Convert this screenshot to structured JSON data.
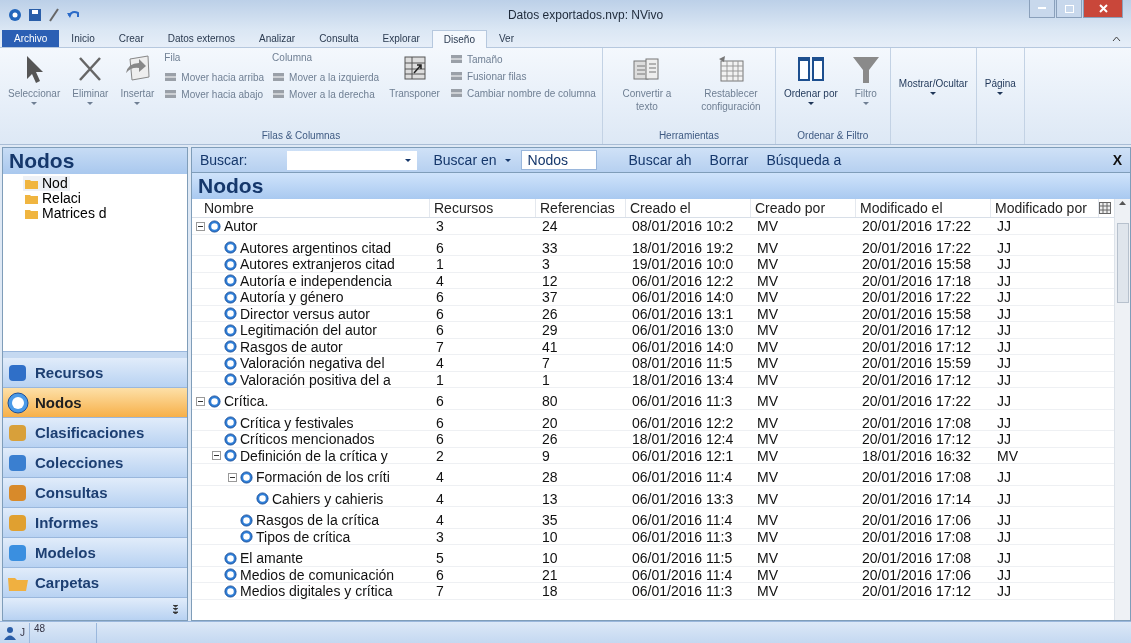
{
  "window": {
    "title": "Datos exportados.nvp: NVivo"
  },
  "ribbon_tabs": [
    {
      "label": "Archivo",
      "kind": "file",
      "selected": false
    },
    {
      "label": "Inicio",
      "kind": "tab",
      "selected": false
    },
    {
      "label": "Crear",
      "kind": "tab",
      "selected": false
    },
    {
      "label": "Datos externos",
      "kind": "tab",
      "selected": false
    },
    {
      "label": "Analizar",
      "kind": "tab",
      "selected": false
    },
    {
      "label": "Consulta",
      "kind": "tab",
      "selected": false
    },
    {
      "label": "Explorar",
      "kind": "tab",
      "selected": false
    },
    {
      "label": "Diseño",
      "kind": "tab",
      "selected": true
    },
    {
      "label": "Ver",
      "kind": "tab",
      "selected": false
    }
  ],
  "ribbon_groups": [
    {
      "label": "Filas & Columnas",
      "items": [
        {
          "kind": "large",
          "label": "Seleccionar",
          "dropdown": true,
          "disabled": true
        },
        {
          "kind": "large",
          "label": "Eliminar",
          "dropdown": true,
          "disabled": true
        },
        {
          "kind": "large",
          "label": "Insertar",
          "dropdown": true,
          "disabled": true
        },
        {
          "kind": "stack",
          "heading": "Fila",
          "entries": [
            {
              "label": "Mover hacia arriba",
              "disabled": true
            },
            {
              "label": "Mover hacia abajo",
              "disabled": true
            }
          ]
        },
        {
          "kind": "stack",
          "heading": "Columna",
          "entries": [
            {
              "label": "Mover a la izquierda",
              "disabled": true
            },
            {
              "label": "Mover a la derecha",
              "disabled": true
            }
          ]
        },
        {
          "kind": "large",
          "label": "Transponer",
          "dropdown": false,
          "disabled": true
        },
        {
          "kind": "stack",
          "entries": [
            {
              "label": "Tamaño",
              "disabled": true
            },
            {
              "label": "Fusionar filas",
              "disabled": true
            },
            {
              "label": "Cambiar nombre de columna",
              "disabled": true
            }
          ]
        }
      ]
    },
    {
      "label": "Herramientas",
      "items": [
        {
          "kind": "large",
          "label": "Convertir a texto",
          "dropdown": false,
          "disabled": true
        },
        {
          "kind": "large",
          "label": "Restablecer configuración",
          "dropdown": false,
          "disabled": true
        }
      ]
    },
    {
      "label": "Ordenar & Filtro",
      "items": [
        {
          "kind": "large",
          "label": "Ordenar por",
          "dropdown": true,
          "disabled": false
        },
        {
          "kind": "large",
          "label": "Filtro",
          "dropdown": true,
          "disabled": true
        }
      ]
    },
    {
      "items": [
        {
          "kind": "text",
          "label": "Mostrar/Ocultar",
          "dropdown": true,
          "disabled": false
        }
      ]
    },
    {
      "items": [
        {
          "kind": "text",
          "label": "Página",
          "dropdown": true,
          "disabled": false
        }
      ]
    }
  ],
  "navigation": {
    "title": "Nodos",
    "folders": [
      {
        "label": "Nod",
        "selected": true
      },
      {
        "label": "Relaci",
        "selected": false
      },
      {
        "label": "Matrices d",
        "selected": false
      }
    ],
    "sections": [
      {
        "label": "Recursos",
        "selected": false
      },
      {
        "label": "Nodos",
        "selected": true
      },
      {
        "label": "Clasificaciones",
        "selected": false
      },
      {
        "label": "Colecciones",
        "selected": false
      },
      {
        "label": "Consultas",
        "selected": false
      },
      {
        "label": "Informes",
        "selected": false
      },
      {
        "label": "Modelos",
        "selected": false
      },
      {
        "label": "Carpetas",
        "selected": false
      }
    ]
  },
  "find_bar": {
    "label": "Buscar:",
    "look_in_label": "Buscar en",
    "look_in_value": "Nodos",
    "find_now": "Buscar ah",
    "clear": "Borrar",
    "advanced": "Búsqueda a",
    "close": "X"
  },
  "list": {
    "title": "Nodos",
    "columns": [
      "Nombre",
      "Recursos",
      "Referencias",
      "Creado el",
      "Creado por",
      "Modificado el",
      "Modificado por"
    ],
    "rows": [
      {
        "name": "Autor",
        "sources": "3",
        "references": "24",
        "created_on": "08/01/2016 10:2",
        "created_by": "MV",
        "modified_on": "20/01/2016 17:22",
        "modified_by": "JJ",
        "expanded": true,
        "children": [
          {
            "name": "Autores argentinos citad",
            "sources": "6",
            "references": "33",
            "created_on": "18/01/2016 19:2",
            "created_by": "MV",
            "modified_on": "20/01/2016 17:22",
            "modified_by": "JJ"
          },
          {
            "name": "Autores extranjeros citad",
            "sources": "1",
            "references": "3",
            "created_on": "19/01/2016 10:0",
            "created_by": "MV",
            "modified_on": "20/01/2016 15:58",
            "modified_by": "JJ"
          },
          {
            "name": "Autoría e independencia",
            "sources": "4",
            "references": "12",
            "created_on": "06/01/2016 12:2",
            "created_by": "MV",
            "modified_on": "20/01/2016 17:18",
            "modified_by": "JJ"
          },
          {
            "name": "Autoría y género",
            "sources": "6",
            "references": "37",
            "created_on": "06/01/2016 14:0",
            "created_by": "MV",
            "modified_on": "20/01/2016 17:22",
            "modified_by": "JJ"
          },
          {
            "name": "Director versus autor",
            "sources": "6",
            "references": "26",
            "created_on": "06/01/2016 13:1",
            "created_by": "MV",
            "modified_on": "20/01/2016 15:58",
            "modified_by": "JJ"
          },
          {
            "name": "Legitimación del autor",
            "sources": "6",
            "references": "29",
            "created_on": "06/01/2016 13:0",
            "created_by": "MV",
            "modified_on": "20/01/2016 17:12",
            "modified_by": "JJ"
          },
          {
            "name": "Rasgos de autor",
            "sources": "7",
            "references": "41",
            "created_on": "06/01/2016 14:0",
            "created_by": "MV",
            "modified_on": "20/01/2016 17:12",
            "modified_by": "JJ"
          },
          {
            "name": "Valoración negativa del",
            "sources": "4",
            "references": "7",
            "created_on": "08/01/2016 11:5",
            "created_by": "MV",
            "modified_on": "20/01/2016 15:59",
            "modified_by": "JJ"
          },
          {
            "name": "Valoración positiva del a",
            "sources": "1",
            "references": "1",
            "created_on": "18/01/2016 13:4",
            "created_by": "MV",
            "modified_on": "20/01/2016 17:12",
            "modified_by": "JJ"
          }
        ]
      },
      {
        "name": "Crítica.",
        "sources": "6",
        "references": "80",
        "created_on": "06/01/2016 11:3",
        "created_by": "MV",
        "modified_on": "20/01/2016 17:22",
        "modified_by": "JJ",
        "expanded": true,
        "children": [
          {
            "name": "Crítica y festivales",
            "sources": "6",
            "references": "20",
            "created_on": "06/01/2016 12:2",
            "created_by": "MV",
            "modified_on": "20/01/2016 17:08",
            "modified_by": "JJ"
          },
          {
            "name": "Críticos mencionados",
            "sources": "6",
            "references": "26",
            "created_on": "18/01/2016 12:4",
            "created_by": "MV",
            "modified_on": "20/01/2016 17:12",
            "modified_by": "JJ"
          },
          {
            "name": "Definición de la crítica y",
            "sources": "2",
            "references": "9",
            "created_on": "06/01/2016 12:1",
            "created_by": "MV",
            "modified_on": "18/01/2016 16:32",
            "modified_by": "MV",
            "expanded": true,
            "children": [
              {
                "name": "Formación de los críti",
                "sources": "4",
                "references": "28",
                "created_on": "06/01/2016 11:4",
                "created_by": "MV",
                "modified_on": "20/01/2016 17:08",
                "modified_by": "JJ",
                "expanded": true,
                "children": [
                  {
                    "name": "Cahiers y cahieris",
                    "sources": "4",
                    "references": "13",
                    "created_on": "06/01/2016 13:3",
                    "created_by": "MV",
                    "modified_on": "20/01/2016 17:14",
                    "modified_by": "JJ"
                  }
                ]
              },
              {
                "name": "Rasgos de la crítica",
                "sources": "4",
                "references": "35",
                "created_on": "06/01/2016 11:4",
                "created_by": "MV",
                "modified_on": "20/01/2016 17:06",
                "modified_by": "JJ"
              },
              {
                "name": "Tipos de crítica",
                "sources": "3",
                "references": "10",
                "created_on": "06/01/2016 11:3",
                "created_by": "MV",
                "modified_on": "20/01/2016 17:08",
                "modified_by": "JJ"
              }
            ]
          },
          {
            "name": "El amante",
            "sources": "5",
            "references": "10",
            "created_on": "06/01/2016 11:5",
            "created_by": "MV",
            "modified_on": "20/01/2016 17:08",
            "modified_by": "JJ"
          },
          {
            "name": "Medios de comunicación",
            "sources": "6",
            "references": "21",
            "created_on": "06/01/2016 11:4",
            "created_by": "MV",
            "modified_on": "20/01/2016 17:06",
            "modified_by": "JJ"
          },
          {
            "name": "Medios digitales y crítica",
            "sources": "7",
            "references": "18",
            "created_on": "06/01/2016 11:3",
            "created_by": "MV",
            "modified_on": "20/01/2016 17:12",
            "modified_by": "JJ"
          }
        ]
      }
    ]
  },
  "status_bar": {
    "user": "J",
    "count": "48"
  }
}
